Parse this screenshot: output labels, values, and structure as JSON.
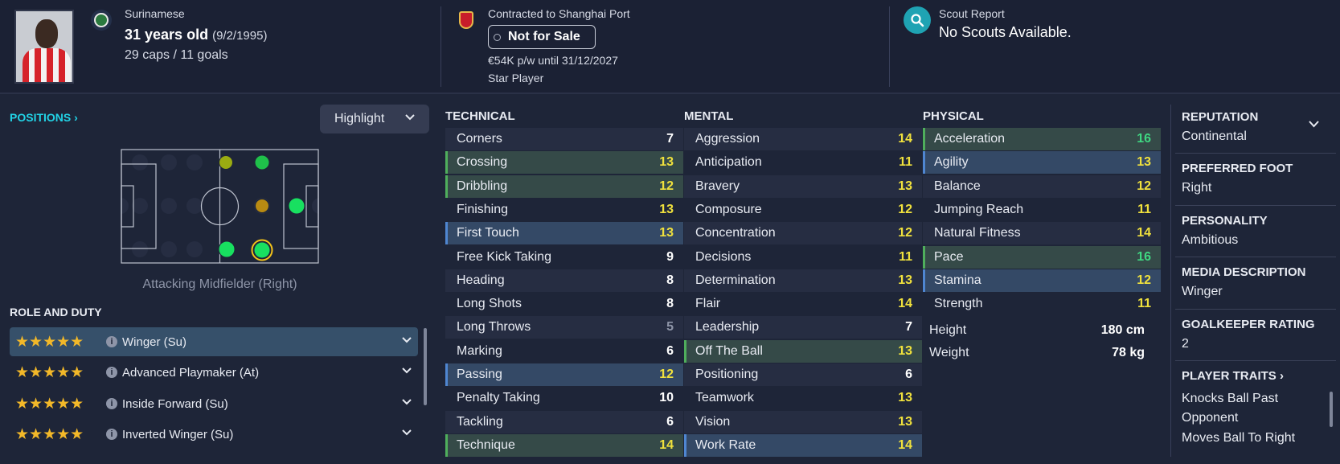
{
  "header": {
    "nationality": "Surinamese",
    "age": "31 years old",
    "dob": "(9/2/1995)",
    "caps": "29 caps / 11 goals",
    "contract": "Contracted to Shanghai Port",
    "transfer_status": "Not for Sale",
    "wage": "€54K p/w until 31/12/2027",
    "player_status": "Star Player",
    "scout_title": "Scout Report",
    "scout_text": "No Scouts Available."
  },
  "positions": {
    "title": "POSITIONS",
    "highlight_label": "Highlight",
    "position_label": "Attacking Midfielder (Right)",
    "pitch_dots": [
      {
        "key": "dl-top",
        "color": "#9aab12"
      },
      {
        "key": "mid-top",
        "color": "#1fc04a"
      },
      {
        "key": "amc-mid",
        "color": "#b88a12"
      },
      {
        "key": "st-right",
        "color": "#18e060"
      },
      {
        "key": "dl-bot",
        "color": "#18e060"
      },
      {
        "key": "amr-bot",
        "color": "#18e060",
        "selected": true
      }
    ]
  },
  "roles": {
    "title": "ROLE AND DUTY",
    "items": [
      {
        "name": "Winger (Su)",
        "stars": "★★★★★",
        "selected": true
      },
      {
        "name": "Advanced Playmaker (At)",
        "stars": "★★★★★"
      },
      {
        "name": "Inside Forward (Su)",
        "stars": "★★★★★"
      },
      {
        "name": "Inverted Winger (Su)",
        "stars": "★★★★★"
      }
    ]
  },
  "colors": {
    "accent_cyan": "#22d3e6",
    "attr_white": "#ffffff",
    "attr_grey": "#8e95a8",
    "attr_yellow": "#f0e13d",
    "attr_green": "#3fd882",
    "highlight_green": "#354a48",
    "highlight_blue": "#344966"
  },
  "technical": {
    "title": "TECHNICAL",
    "items": [
      {
        "name": "Corners",
        "value": "7",
        "tone": "white",
        "hl": ""
      },
      {
        "name": "Crossing",
        "value": "13",
        "tone": "yellow",
        "hl": "green"
      },
      {
        "name": "Dribbling",
        "value": "12",
        "tone": "yellow",
        "hl": "green"
      },
      {
        "name": "Finishing",
        "value": "13",
        "tone": "yellow",
        "hl": ""
      },
      {
        "name": "First Touch",
        "value": "13",
        "tone": "yellow",
        "hl": "blue"
      },
      {
        "name": "Free Kick Taking",
        "value": "9",
        "tone": "white",
        "hl": ""
      },
      {
        "name": "Heading",
        "value": "8",
        "tone": "white",
        "hl": ""
      },
      {
        "name": "Long Shots",
        "value": "8",
        "tone": "white",
        "hl": ""
      },
      {
        "name": "Long Throws",
        "value": "5",
        "tone": "grey",
        "hl": ""
      },
      {
        "name": "Marking",
        "value": "6",
        "tone": "white",
        "hl": ""
      },
      {
        "name": "Passing",
        "value": "12",
        "tone": "yellow",
        "hl": "blue"
      },
      {
        "name": "Penalty Taking",
        "value": "10",
        "tone": "white",
        "hl": ""
      },
      {
        "name": "Tackling",
        "value": "6",
        "tone": "white",
        "hl": ""
      },
      {
        "name": "Technique",
        "value": "14",
        "tone": "yellow",
        "hl": "green"
      }
    ]
  },
  "mental": {
    "title": "MENTAL",
    "items": [
      {
        "name": "Aggression",
        "value": "14",
        "tone": "yellow",
        "hl": ""
      },
      {
        "name": "Anticipation",
        "value": "11",
        "tone": "yellow",
        "hl": ""
      },
      {
        "name": "Bravery",
        "value": "13",
        "tone": "yellow",
        "hl": ""
      },
      {
        "name": "Composure",
        "value": "12",
        "tone": "yellow",
        "hl": ""
      },
      {
        "name": "Concentration",
        "value": "12",
        "tone": "yellow",
        "hl": ""
      },
      {
        "name": "Decisions",
        "value": "11",
        "tone": "yellow",
        "hl": ""
      },
      {
        "name": "Determination",
        "value": "13",
        "tone": "yellow",
        "hl": ""
      },
      {
        "name": "Flair",
        "value": "14",
        "tone": "yellow",
        "hl": ""
      },
      {
        "name": "Leadership",
        "value": "7",
        "tone": "white",
        "hl": ""
      },
      {
        "name": "Off The Ball",
        "value": "13",
        "tone": "yellow",
        "hl": "green"
      },
      {
        "name": "Positioning",
        "value": "6",
        "tone": "white",
        "hl": ""
      },
      {
        "name": "Teamwork",
        "value": "13",
        "tone": "yellow",
        "hl": ""
      },
      {
        "name": "Vision",
        "value": "13",
        "tone": "yellow",
        "hl": ""
      },
      {
        "name": "Work Rate",
        "value": "14",
        "tone": "yellow",
        "hl": "blue"
      }
    ]
  },
  "physical": {
    "title": "PHYSICAL",
    "items": [
      {
        "name": "Acceleration",
        "value": "16",
        "tone": "green",
        "hl": "green"
      },
      {
        "name": "Agility",
        "value": "13",
        "tone": "yellow",
        "hl": "blue"
      },
      {
        "name": "Balance",
        "value": "12",
        "tone": "yellow",
        "hl": ""
      },
      {
        "name": "Jumping Reach",
        "value": "11",
        "tone": "yellow",
        "hl": ""
      },
      {
        "name": "Natural Fitness",
        "value": "14",
        "tone": "yellow",
        "hl": ""
      },
      {
        "name": "Pace",
        "value": "16",
        "tone": "green",
        "hl": "green"
      },
      {
        "name": "Stamina",
        "value": "12",
        "tone": "yellow",
        "hl": "blue"
      },
      {
        "name": "Strength",
        "value": "11",
        "tone": "yellow",
        "hl": ""
      }
    ],
    "height_label": "Height",
    "height": "180 cm",
    "weight_label": "Weight",
    "weight": "78 kg"
  },
  "info": {
    "reputation_title": "REPUTATION",
    "reputation": "Continental",
    "foot_title": "PREFERRED FOOT",
    "foot": "Right",
    "personality_title": "PERSONALITY",
    "personality": "Ambitious",
    "media_title": "MEDIA DESCRIPTION",
    "media": "Winger",
    "gk_title": "GOALKEEPER RATING",
    "gk": "2",
    "traits_title": "PLAYER TRAITS",
    "traits": [
      "Knocks Ball Past",
      "Opponent",
      "Moves Ball To Right"
    ]
  }
}
